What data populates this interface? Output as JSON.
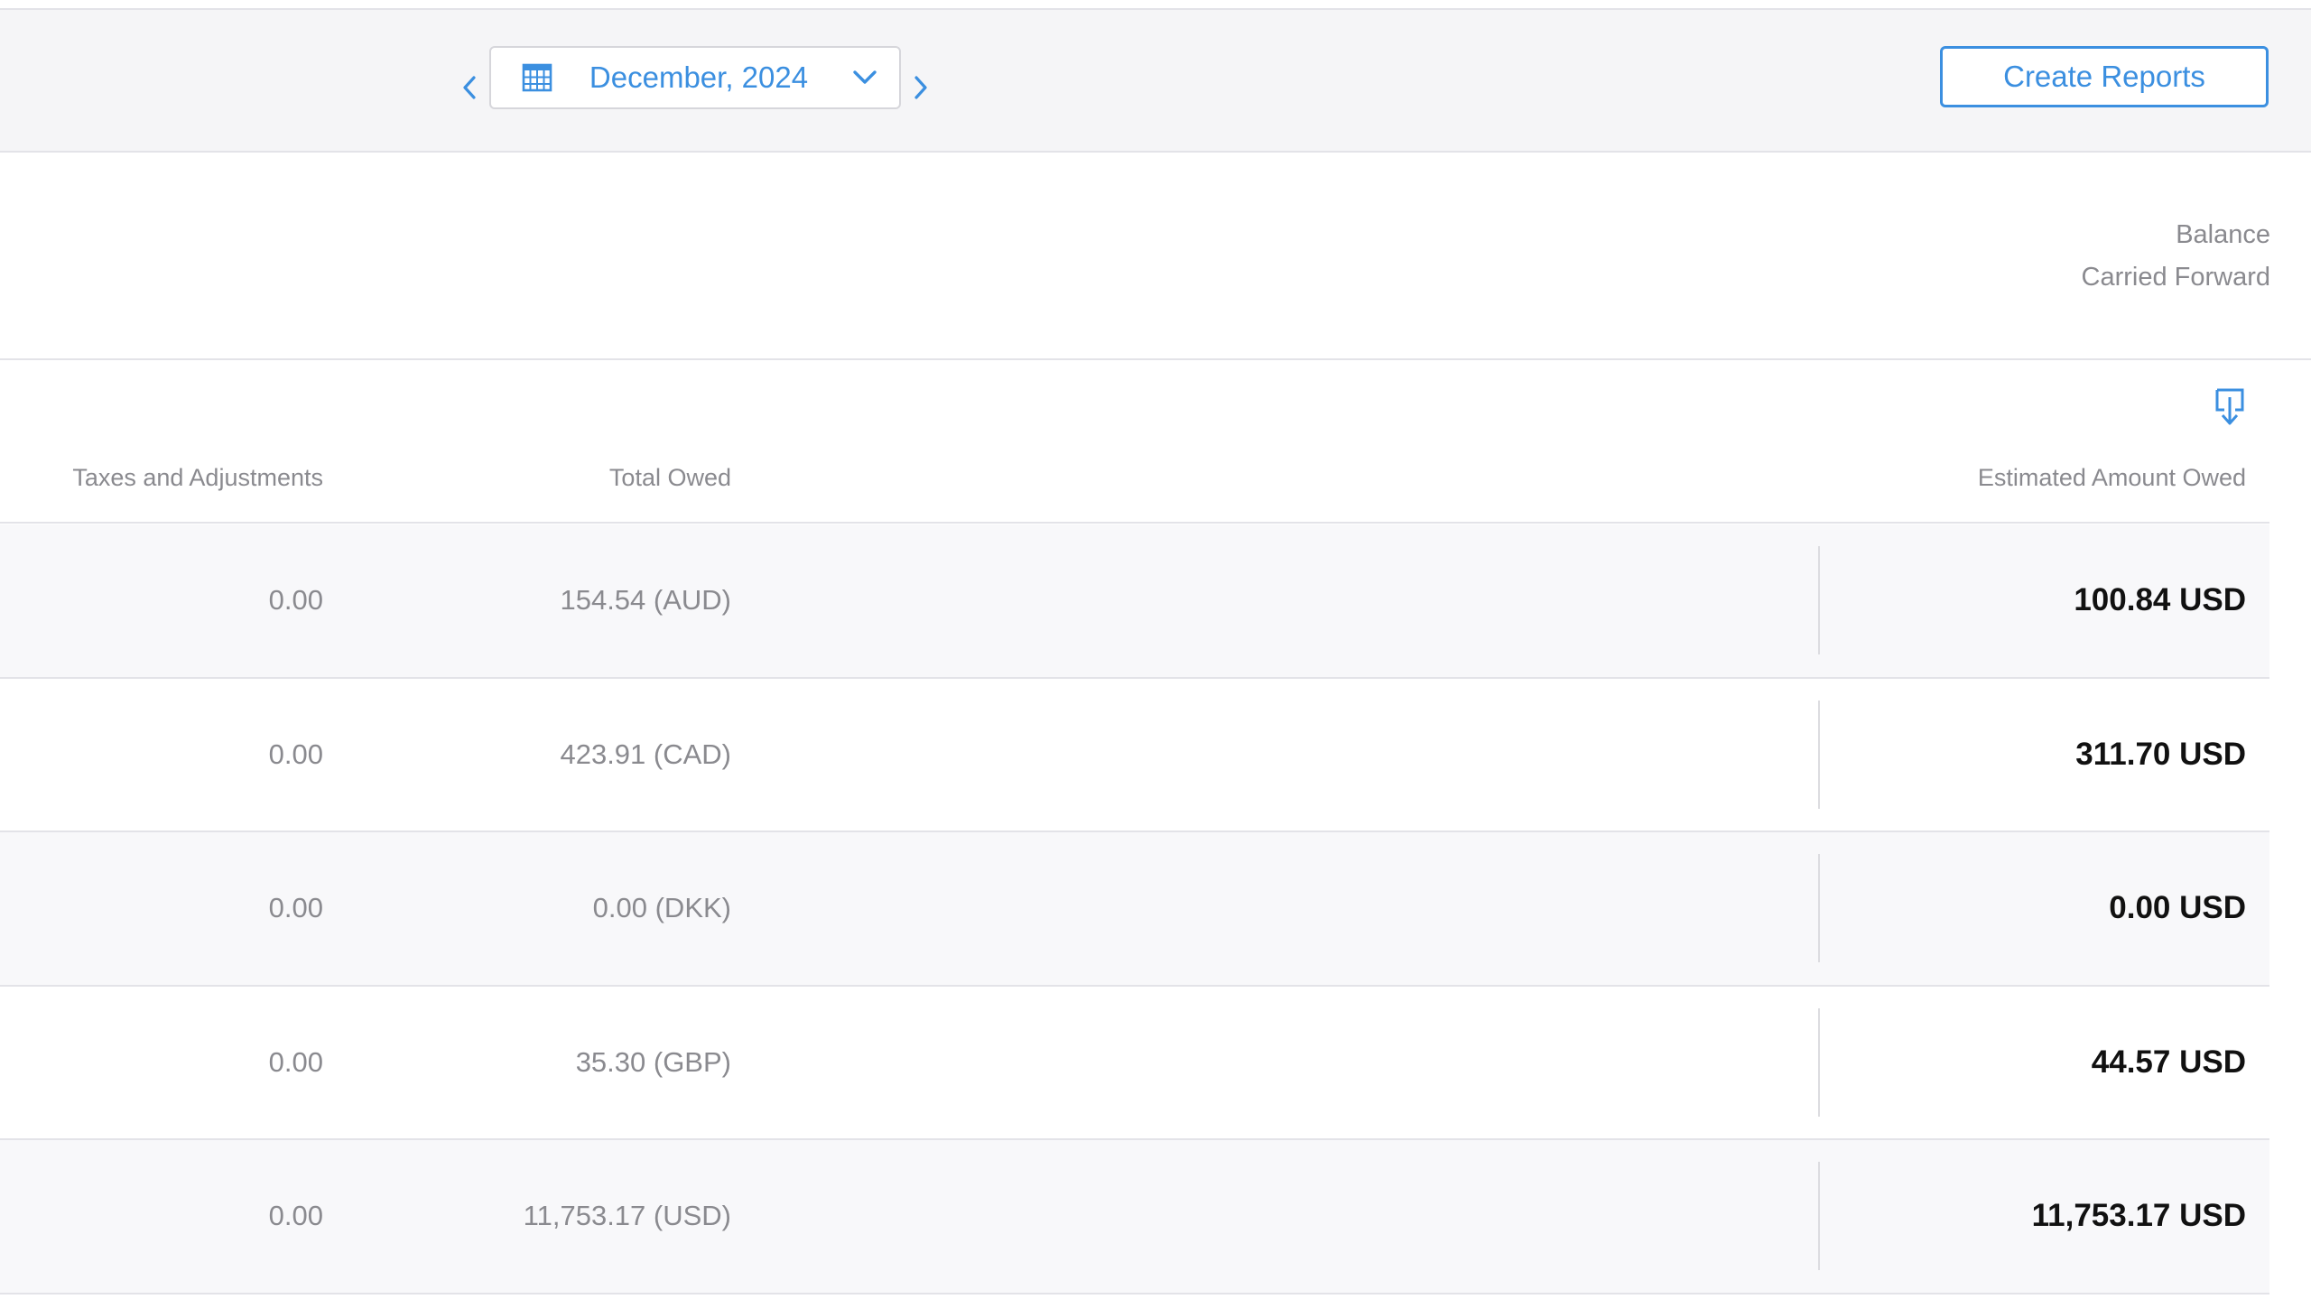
{
  "toolbar": {
    "date_label": "December, 2024",
    "create_reports_label": "Create Reports"
  },
  "summary": {
    "balance_line1": "Balance",
    "balance_line2": "Carried Forward"
  },
  "table": {
    "headers": {
      "taxes": "Taxes and Adjustments",
      "total_owed": "Total Owed",
      "estimated": "Estimated Amount Owed"
    },
    "rows": [
      {
        "taxes": "0.00",
        "total_owed": "154.54 (AUD)",
        "estimated": "100.84 USD"
      },
      {
        "taxes": "0.00",
        "total_owed": "423.91 (CAD)",
        "estimated": "311.70 USD"
      },
      {
        "taxes": "0.00",
        "total_owed": "0.00 (DKK)",
        "estimated": "0.00 USD"
      },
      {
        "taxes": "0.00",
        "total_owed": "35.30 (GBP)",
        "estimated": "44.57 USD"
      },
      {
        "taxes": "0.00",
        "total_owed": "11,753.17 (USD)",
        "estimated": "11,753.17 USD"
      }
    ]
  },
  "icons": {
    "prev": "chevron-left-icon",
    "next": "chevron-right-icon",
    "calendar": "calendar-icon",
    "dropdown": "chevron-down-icon",
    "export": "download-icon"
  },
  "colors": {
    "accent": "#3b8fe0",
    "muted_text": "#8a8a8f",
    "strong_text": "#111111",
    "toolbar_bg": "#f5f5f7",
    "row_shaded": "#f8f8fa"
  }
}
